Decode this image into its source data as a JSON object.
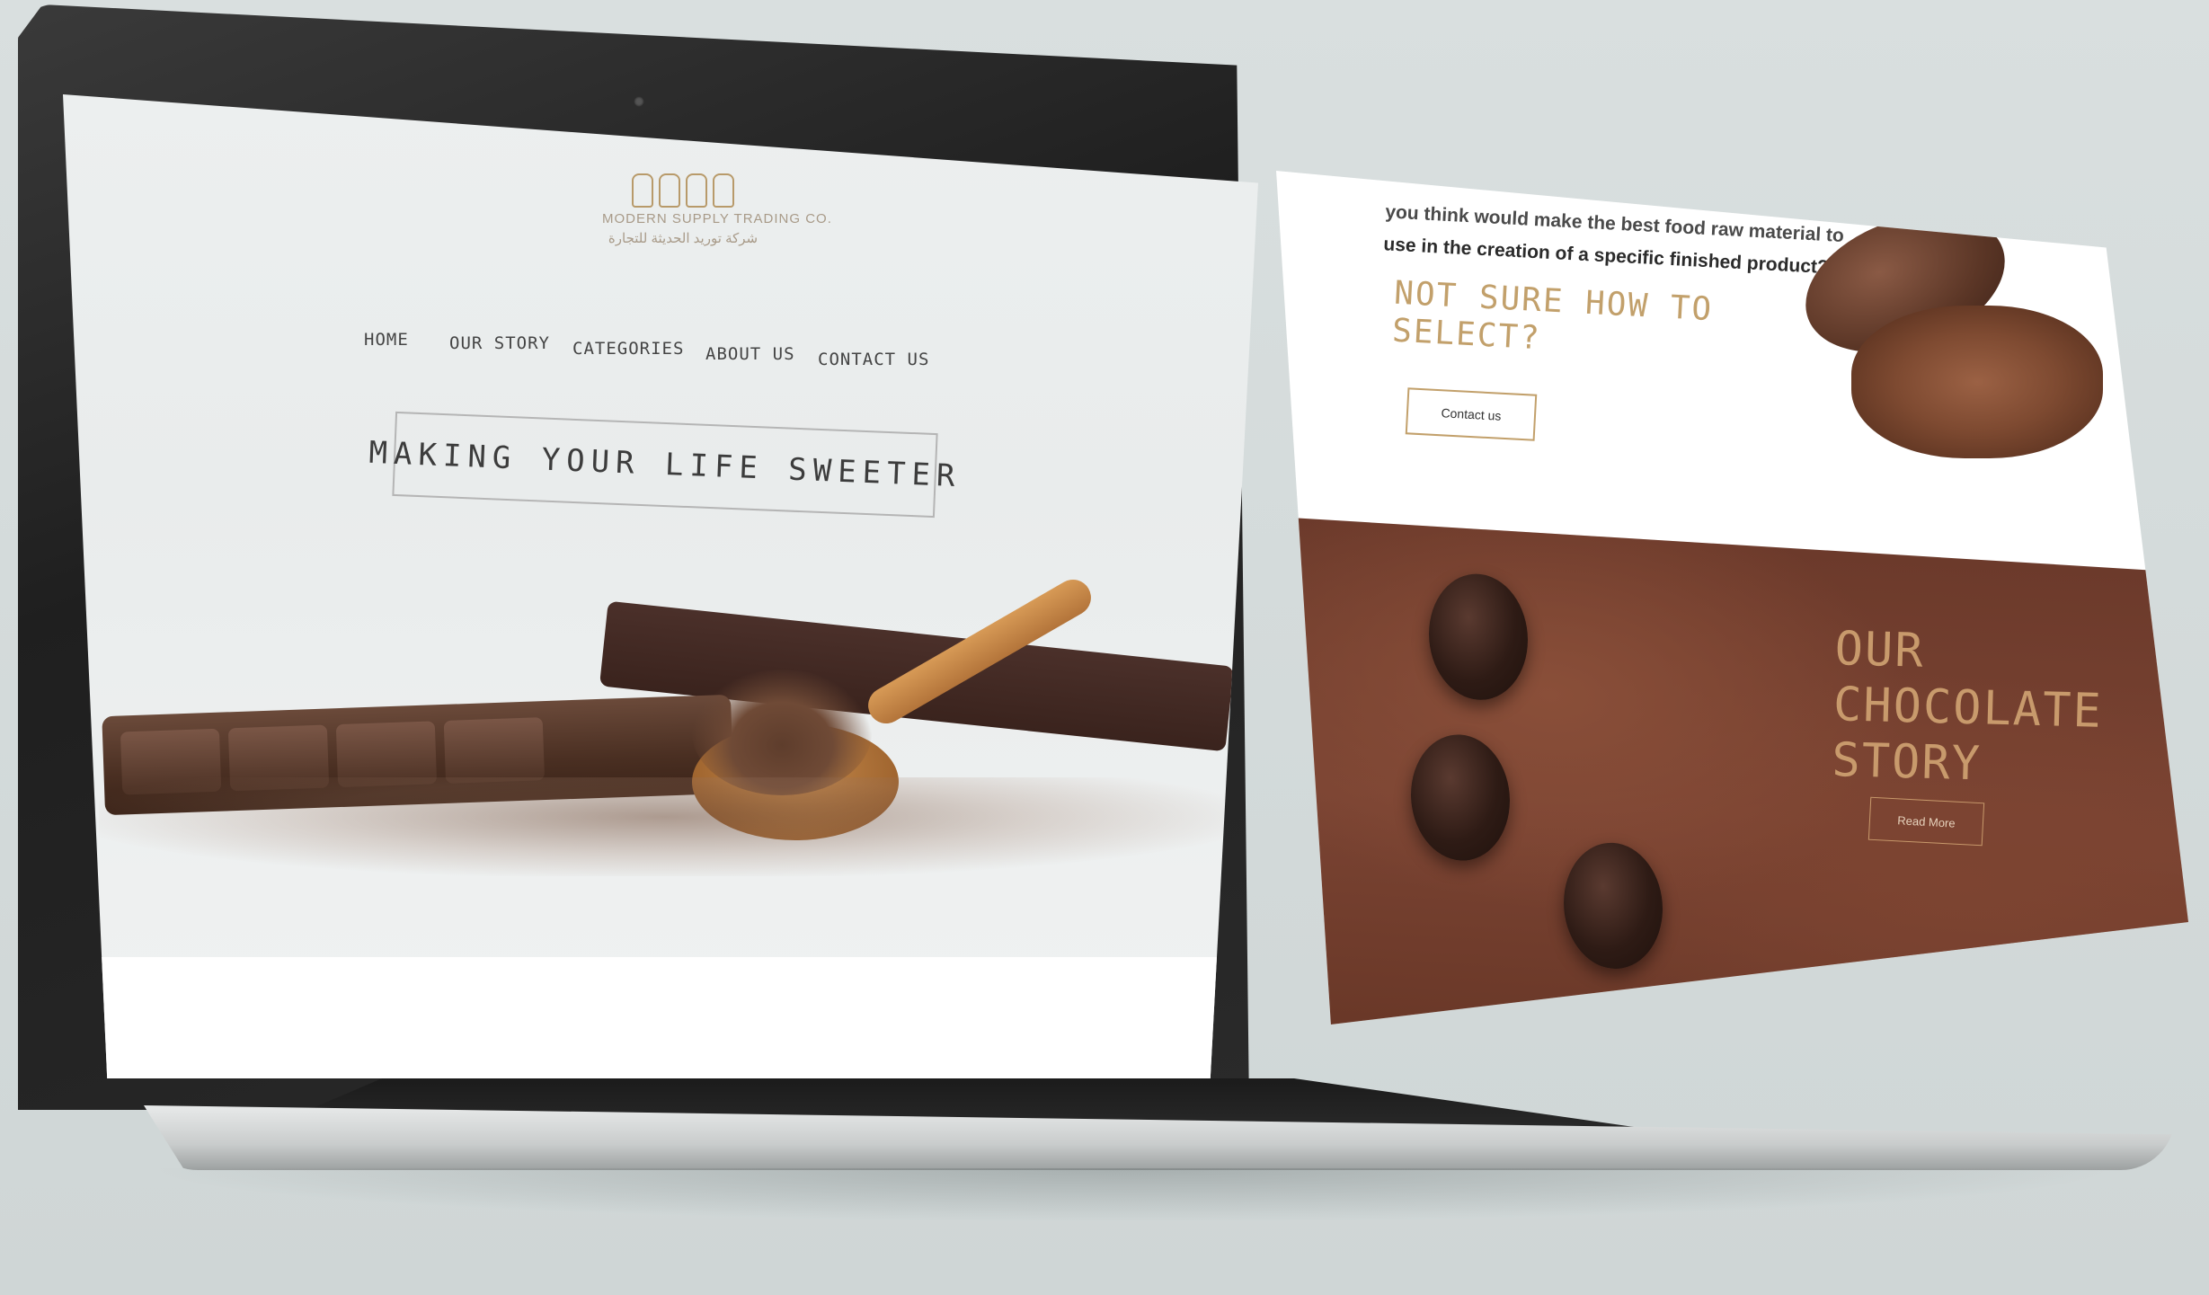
{
  "site": {
    "logo_line_1": "MODERN SUPPLY TRADING CO.",
    "logo_line_2": "شركة توريد الحديثة للتجارة",
    "nav": [
      {
        "label": "HOME"
      },
      {
        "label": "OUR STORY"
      },
      {
        "label": "CATEGORIES"
      },
      {
        "label": "ABOUT US"
      },
      {
        "label": "CONTACT US"
      }
    ],
    "hero_title": "MAKING YOUR LIFE SWEETER"
  },
  "panel": {
    "partial_text_line_1": "you think would make the best food raw material to",
    "partial_text_line_2": "use in the creation of a specific finished product?",
    "heading": "NOT SURE HOW TO SELECT?",
    "contact_button": "Contact us",
    "story_heading": "OUR CHOCOLATE STORY",
    "read_more_button": "Read More"
  },
  "colors": {
    "accent_gold": "#c2a06b",
    "chocolate_brown": "#6c3a2b"
  }
}
